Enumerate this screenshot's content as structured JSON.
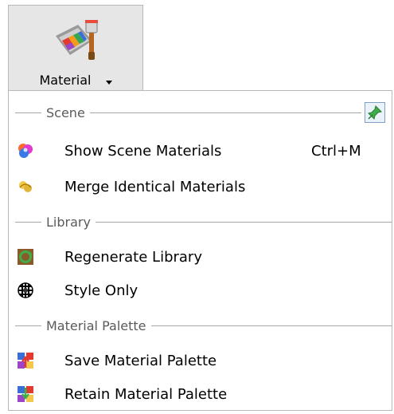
{
  "ribbon": {
    "label": "Material",
    "icon": "material-paint-icon"
  },
  "menu": {
    "groups": [
      {
        "title": "Scene",
        "items": [
          {
            "label": "Show Scene Materials",
            "shortcut": "Ctrl+M",
            "icon": "scene-materials-icon"
          },
          {
            "label": "Merge Identical Materials",
            "shortcut": "",
            "icon": "merge-materials-icon"
          }
        ]
      },
      {
        "title": "Library",
        "items": [
          {
            "label": "Regenerate Library",
            "shortcut": "",
            "icon": "regenerate-library-icon"
          },
          {
            "label": "Style Only",
            "shortcut": "",
            "icon": "style-only-icon"
          }
        ]
      },
      {
        "title": "Material Palette",
        "items": [
          {
            "label": "Save Material Palette",
            "shortcut": "",
            "icon": "save-palette-icon"
          },
          {
            "label": "Retain Material Palette",
            "shortcut": "",
            "icon": "retain-palette-icon"
          }
        ]
      }
    ],
    "pin_icon": "pin-icon"
  },
  "colors": {
    "ribbon_bg": "#e6e6e6",
    "border": "#b8b8b8",
    "group_text": "#5a5a5a",
    "pin_border": "#7fa0c0",
    "pin_bg": "#eaf2fa"
  }
}
